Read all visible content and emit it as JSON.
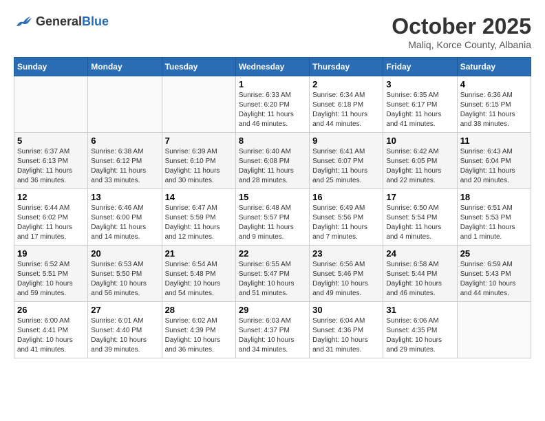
{
  "logo": {
    "general": "General",
    "blue": "Blue"
  },
  "header": {
    "month": "October 2025",
    "location": "Maliq, Korce County, Albania"
  },
  "weekdays": [
    "Sunday",
    "Monday",
    "Tuesday",
    "Wednesday",
    "Thursday",
    "Friday",
    "Saturday"
  ],
  "weeks": [
    [
      {
        "day": "",
        "info": ""
      },
      {
        "day": "",
        "info": ""
      },
      {
        "day": "",
        "info": ""
      },
      {
        "day": "1",
        "info": "Sunrise: 6:33 AM\nSunset: 6:20 PM\nDaylight: 11 hours\nand 46 minutes."
      },
      {
        "day": "2",
        "info": "Sunrise: 6:34 AM\nSunset: 6:18 PM\nDaylight: 11 hours\nand 44 minutes."
      },
      {
        "day": "3",
        "info": "Sunrise: 6:35 AM\nSunset: 6:17 PM\nDaylight: 11 hours\nand 41 minutes."
      },
      {
        "day": "4",
        "info": "Sunrise: 6:36 AM\nSunset: 6:15 PM\nDaylight: 11 hours\nand 38 minutes."
      }
    ],
    [
      {
        "day": "5",
        "info": "Sunrise: 6:37 AM\nSunset: 6:13 PM\nDaylight: 11 hours\nand 36 minutes."
      },
      {
        "day": "6",
        "info": "Sunrise: 6:38 AM\nSunset: 6:12 PM\nDaylight: 11 hours\nand 33 minutes."
      },
      {
        "day": "7",
        "info": "Sunrise: 6:39 AM\nSunset: 6:10 PM\nDaylight: 11 hours\nand 30 minutes."
      },
      {
        "day": "8",
        "info": "Sunrise: 6:40 AM\nSunset: 6:08 PM\nDaylight: 11 hours\nand 28 minutes."
      },
      {
        "day": "9",
        "info": "Sunrise: 6:41 AM\nSunset: 6:07 PM\nDaylight: 11 hours\nand 25 minutes."
      },
      {
        "day": "10",
        "info": "Sunrise: 6:42 AM\nSunset: 6:05 PM\nDaylight: 11 hours\nand 22 minutes."
      },
      {
        "day": "11",
        "info": "Sunrise: 6:43 AM\nSunset: 6:04 PM\nDaylight: 11 hours\nand 20 minutes."
      }
    ],
    [
      {
        "day": "12",
        "info": "Sunrise: 6:44 AM\nSunset: 6:02 PM\nDaylight: 11 hours\nand 17 minutes."
      },
      {
        "day": "13",
        "info": "Sunrise: 6:46 AM\nSunset: 6:00 PM\nDaylight: 11 hours\nand 14 minutes."
      },
      {
        "day": "14",
        "info": "Sunrise: 6:47 AM\nSunset: 5:59 PM\nDaylight: 11 hours\nand 12 minutes."
      },
      {
        "day": "15",
        "info": "Sunrise: 6:48 AM\nSunset: 5:57 PM\nDaylight: 11 hours\nand 9 minutes."
      },
      {
        "day": "16",
        "info": "Sunrise: 6:49 AM\nSunset: 5:56 PM\nDaylight: 11 hours\nand 7 minutes."
      },
      {
        "day": "17",
        "info": "Sunrise: 6:50 AM\nSunset: 5:54 PM\nDaylight: 11 hours\nand 4 minutes."
      },
      {
        "day": "18",
        "info": "Sunrise: 6:51 AM\nSunset: 5:53 PM\nDaylight: 11 hours\nand 1 minute."
      }
    ],
    [
      {
        "day": "19",
        "info": "Sunrise: 6:52 AM\nSunset: 5:51 PM\nDaylight: 10 hours\nand 59 minutes."
      },
      {
        "day": "20",
        "info": "Sunrise: 6:53 AM\nSunset: 5:50 PM\nDaylight: 10 hours\nand 56 minutes."
      },
      {
        "day": "21",
        "info": "Sunrise: 6:54 AM\nSunset: 5:48 PM\nDaylight: 10 hours\nand 54 minutes."
      },
      {
        "day": "22",
        "info": "Sunrise: 6:55 AM\nSunset: 5:47 PM\nDaylight: 10 hours\nand 51 minutes."
      },
      {
        "day": "23",
        "info": "Sunrise: 6:56 AM\nSunset: 5:46 PM\nDaylight: 10 hours\nand 49 minutes."
      },
      {
        "day": "24",
        "info": "Sunrise: 6:58 AM\nSunset: 5:44 PM\nDaylight: 10 hours\nand 46 minutes."
      },
      {
        "day": "25",
        "info": "Sunrise: 6:59 AM\nSunset: 5:43 PM\nDaylight: 10 hours\nand 44 minutes."
      }
    ],
    [
      {
        "day": "26",
        "info": "Sunrise: 6:00 AM\nSunset: 4:41 PM\nDaylight: 10 hours\nand 41 minutes."
      },
      {
        "day": "27",
        "info": "Sunrise: 6:01 AM\nSunset: 4:40 PM\nDaylight: 10 hours\nand 39 minutes."
      },
      {
        "day": "28",
        "info": "Sunrise: 6:02 AM\nSunset: 4:39 PM\nDaylight: 10 hours\nand 36 minutes."
      },
      {
        "day": "29",
        "info": "Sunrise: 6:03 AM\nSunset: 4:37 PM\nDaylight: 10 hours\nand 34 minutes."
      },
      {
        "day": "30",
        "info": "Sunrise: 6:04 AM\nSunset: 4:36 PM\nDaylight: 10 hours\nand 31 minutes."
      },
      {
        "day": "31",
        "info": "Sunrise: 6:06 AM\nSunset: 4:35 PM\nDaylight: 10 hours\nand 29 minutes."
      },
      {
        "day": "",
        "info": ""
      }
    ]
  ]
}
